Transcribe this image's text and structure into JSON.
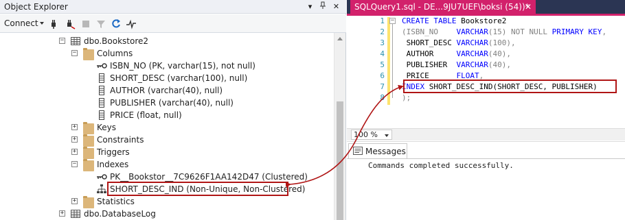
{
  "object_explorer": {
    "title": "Object Explorer",
    "title_buttons": [
      "▾",
      "📌",
      "✕"
    ],
    "connect_label": "Connect",
    "tree": [
      {
        "label": "dbo.Bookstore2",
        "kind": "table",
        "expander": "−"
      },
      {
        "label": "Columns",
        "kind": "folder",
        "expander": "−"
      },
      {
        "label": "ISBN_NO (PK, varchar(15), not null)",
        "kind": "key"
      },
      {
        "label": "SHORT_DESC (varchar(100), null)",
        "kind": "column"
      },
      {
        "label": "AUTHOR (varchar(40), null)",
        "kind": "column"
      },
      {
        "label": "PUBLISHER (varchar(40), null)",
        "kind": "column"
      },
      {
        "label": "PRICE (float, null)",
        "kind": "column"
      },
      {
        "label": "Keys",
        "kind": "folder",
        "expander": "+"
      },
      {
        "label": "Constraints",
        "kind": "folder",
        "expander": "+"
      },
      {
        "label": "Triggers",
        "kind": "folder",
        "expander": "+"
      },
      {
        "label": "Indexes",
        "kind": "folder",
        "expander": "−"
      },
      {
        "label": "PK__Bookstor__7C9626F1AA142D47 (Clustered)",
        "kind": "pkindex"
      },
      {
        "label": "SHORT_DESC_IND (Non-Unique, Non-Clustered)",
        "kind": "index"
      },
      {
        "label": "Statistics",
        "kind": "folder",
        "expander": "+"
      },
      {
        "label": "dbo.DatabaseLog",
        "kind": "table",
        "expander": "+"
      }
    ]
  },
  "query_editor": {
    "tab_title": "SQLQuery1.sql - DE...9JU7UEF\\boksi (54))*",
    "tab_close": "✕",
    "line_numbers": [
      "1",
      "2",
      "3",
      "4",
      "5",
      "6",
      "7",
      "8"
    ],
    "code": {
      "l1_kw": "CREATE TABLE",
      "l1_rest": " Bookstore2",
      "l2_a": "(ISBN_NO    ",
      "l2_type": "VARCHAR",
      "l2_b": "(15) ",
      "l2_null": "NOT NULL",
      "l2_pk": " PRIMARY KEY",
      "l2_c": ",",
      "l3_a": " SHORT_DESC ",
      "l3_type": "VARCHAR",
      "l3_b": "(100),",
      "l4_a": " AUTHOR     ",
      "l4_type": "VARCHAR",
      "l4_b": "(40),",
      "l5_a": " PUBLISHER  ",
      "l5_type": "VARCHAR",
      "l5_b": "(40),",
      "l6_a": " PRICE      ",
      "l6_type": "FLOAT",
      "l6_b": ",",
      "l7_kw": "INDEX",
      "l7_rest": " SHORT_DESC_IND(SHORT_DESC, PUBLISHER)",
      "l8": ");"
    },
    "zoom": "100 %",
    "messages_tab": "Messages",
    "message_text": "Commands completed successfully."
  },
  "colors": {
    "tab_accent": "#d2216b",
    "highlight": "#b01515",
    "keyword": "#0000ff",
    "line_number": "#2b91af"
  }
}
